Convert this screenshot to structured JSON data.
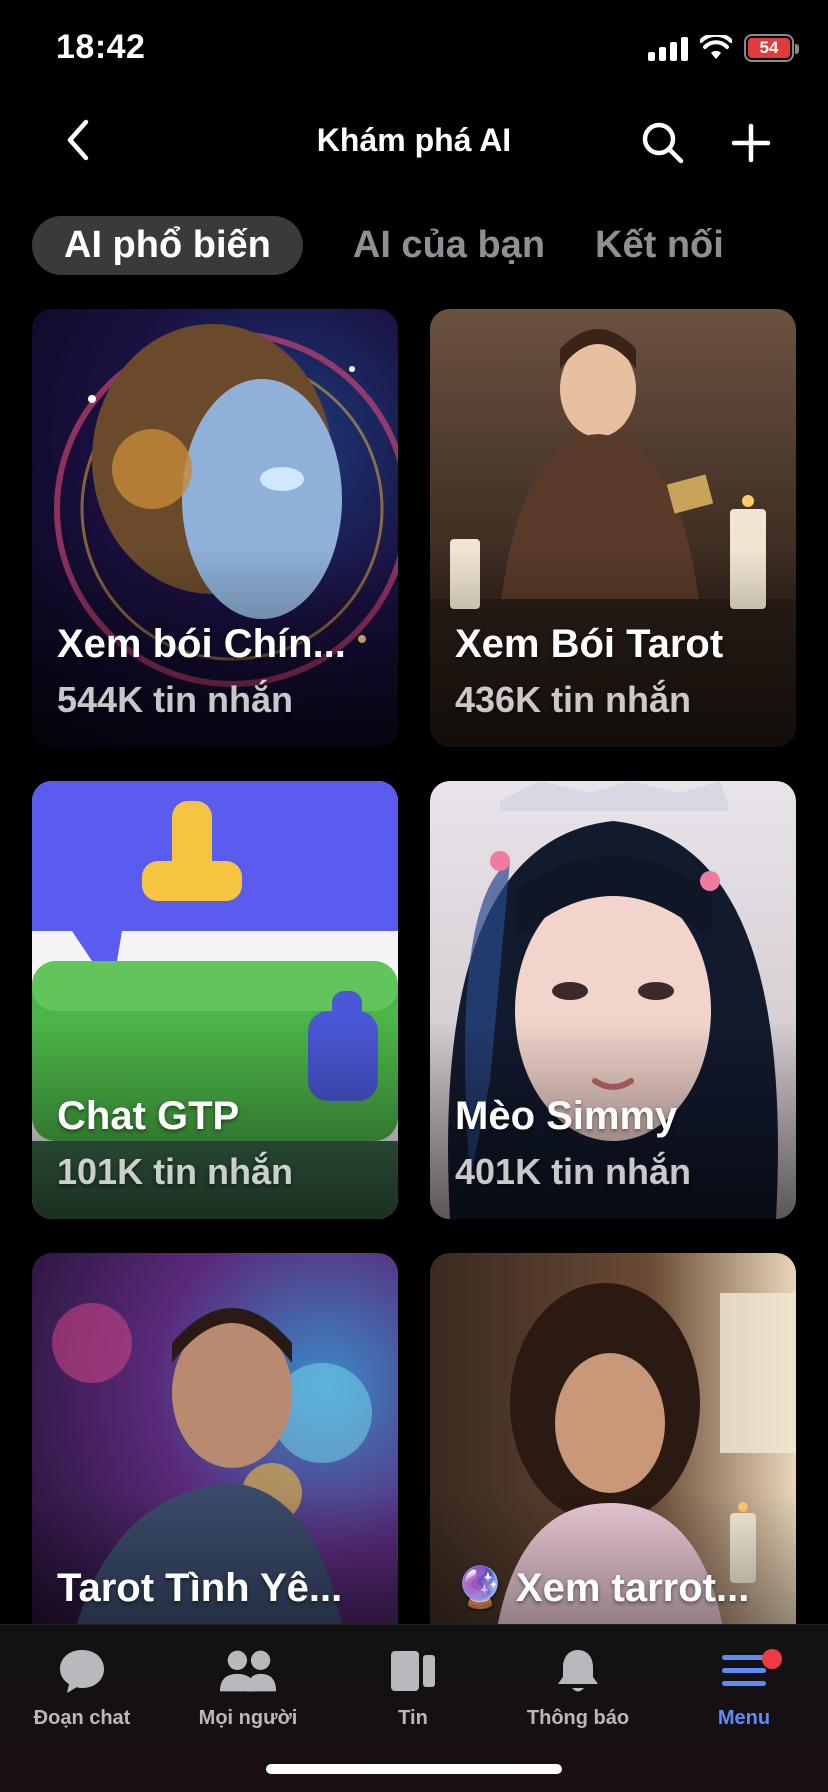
{
  "status_bar": {
    "time": "18:42",
    "battery": "54"
  },
  "header": {
    "title": "Khám phá AI"
  },
  "tabs": [
    {
      "label": "AI phổ biến",
      "active": true
    },
    {
      "label": "AI của bạn",
      "active": false
    },
    {
      "label": "Kết nối",
      "active": false
    }
  ],
  "cards": [
    {
      "name": "Xem bói Chín...",
      "count": "544K tin nhắn"
    },
    {
      "name": "Xem Bói Tarot",
      "count": "436K tin nhắn"
    },
    {
      "name": "Chat GTP",
      "count": "101K tin nhắn"
    },
    {
      "name": "Mèo Simmy",
      "count": "401K tin nhắn"
    },
    {
      "name": "Tarot Tình Yê...",
      "count": ""
    },
    {
      "name": "🔮 Xem tarrot...",
      "count": ""
    }
  ],
  "nav": [
    {
      "label": "Đoạn chat",
      "icon": "chat-bubble-icon"
    },
    {
      "label": "Mọi người",
      "icon": "people-icon"
    },
    {
      "label": "Tin",
      "icon": "stories-icon"
    },
    {
      "label": "Thông báo",
      "icon": "bell-icon"
    },
    {
      "label": "Menu",
      "icon": "menu-icon",
      "active": true,
      "badge": true
    }
  ],
  "colors": {
    "accent": "#5e8cf6",
    "badge": "#ee3a45",
    "tab_active_bg": "#3a3a3c",
    "tab_inactive": "#8f8f94"
  }
}
